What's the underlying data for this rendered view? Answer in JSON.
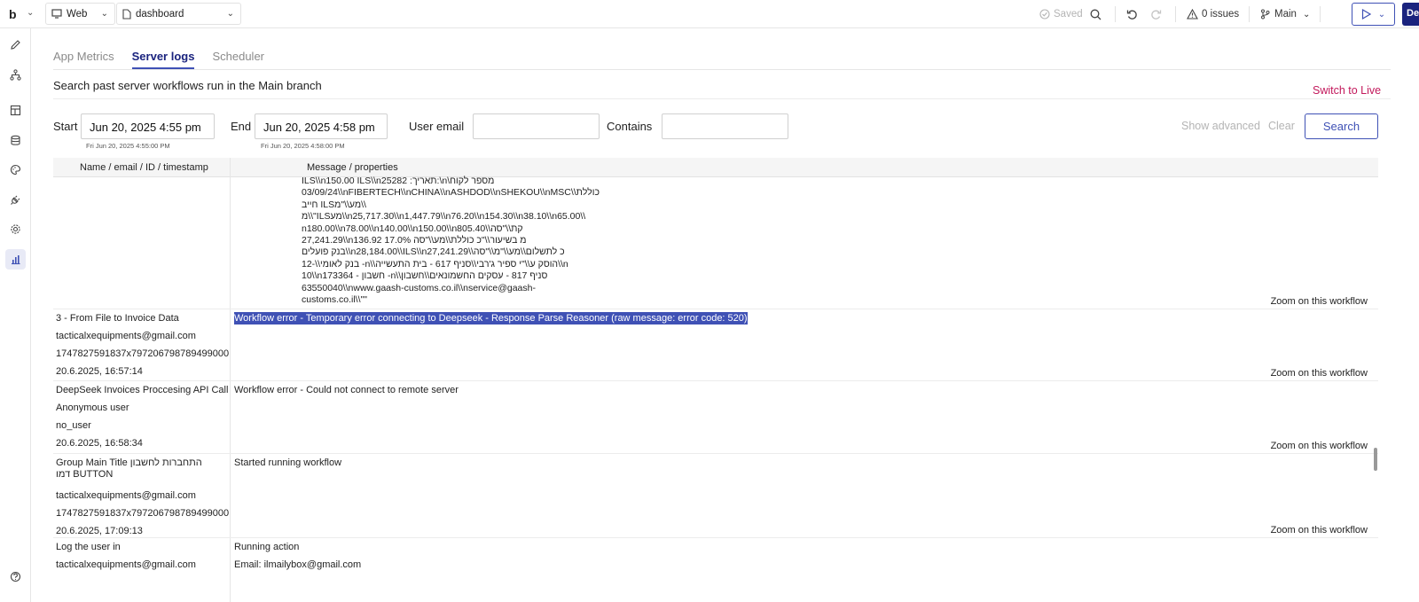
{
  "topbar": {
    "logo": "b",
    "platform": "Web",
    "page": "dashboard",
    "saved": "Saved",
    "issues": "0 issues",
    "branch": "Main",
    "deploy": "Deploy"
  },
  "tabs": [
    "App Metrics",
    "Server logs",
    "Scheduler"
  ],
  "description": "Search past server workflows run in the Main branch",
  "switch_live": "Switch to Live",
  "filters": {
    "start_label": "Start",
    "start_value": "Jun 20, 2025 4:55 pm",
    "start_sub": "Fri Jun 20, 2025 4:55:00 PM",
    "end_label": "End",
    "end_value": "Jun 20, 2025 4:58 pm",
    "end_sub": "Fri Jun 20, 2025 4:58:00 PM",
    "email_label": "User email",
    "email_value": "",
    "contains_label": "Contains",
    "contains_value": "",
    "show_advanced": "Show advanced",
    "clear": "Clear",
    "search": "Search"
  },
  "table": {
    "headers": [
      "Name / email / ID / timestamp",
      "Message / properties"
    ],
    "zoom_label": "Zoom on this workflow",
    "first_row_lines": [
      "ILS\\\\n150.00 ILS\\\\n25282 :תאריך:\\n\\מספר לקוח",
      "03/09/24\\\\nFIBERTECH\\\\nCHINA\\\\nASHDOD\\\\nSHEKOU\\\\nMSC\\\\כוללת",
      "חייב ILSמע\\\\\"מ\\\\",
      "מ\\\\\"ILSמע\\\\n25,717.30\\\\n1,447.79\\\\n76.20\\\\n154.30\\\\n38.10\\\\n65.00\\\\",
      "n180.00\\\\n78.00\\\\n140.00\\\\n150.00\\\\n805.40\\\\קת\\\\\"סה",
      "27,241.29\\\\n136.92 17.0% מ בשיעור\\\\\"כ כוללת\\\\מע\\\\\"סה",
      "בנק פועלים\\\\n28,184.00\\\\ILS\\\\n27,241.29\\\\כ לתשלום\\\\מע\\\\\"מ\\\\\"סה",
      "12-\\\\בנק לאומי -n\\\\הוסק ע\\\\\"י ספיר ג'רבי\\\\סניף 617 - בית התעשייה\\\\n",
      "10\\\\n173364 - חשבון -n\\\\סניף 817 - עסקים החשמונאים\\\\חשבון",
      "63550040\\\\nwww.gaash-customs.co.il\\\\nservice@gaash-",
      "customs.co.il\\\\\"\""
    ],
    "rows": [
      {
        "name": "3 - From File to Invoice Data",
        "email": "tacticalxequipments@gmail.com",
        "id": "1747827591837x797206798789499000",
        "timestamp": "20.6.2025, 16:57:14",
        "message": "Workflow error - Temporary error connecting to Deepseek - Response Parse Reasoner (raw message: error code: 520)"
      },
      {
        "name": "DeepSeek Invoices Proccesing API Call",
        "email": "Anonymous user",
        "id": "no_user",
        "timestamp": "20.6.2025, 16:58:34",
        "message": "Workflow error - Could not connect to remote server"
      },
      {
        "name": "Group Main Title התחברות לחשבון דמו BUTTON",
        "email": "tacticalxequipments@gmail.com",
        "id": "1747827591837x797206798789499000",
        "timestamp": "20.6.2025, 17:09:13",
        "message": "Started running workflow"
      },
      {
        "name": "Log the user in",
        "email": "tacticalxequipments@gmail.com",
        "message": "Running action",
        "message2": "Email: ilmailybox@gmail.com"
      }
    ]
  },
  "colors": {
    "accent": "#3f51b5",
    "accent_dark": "#1a237e",
    "switch_live": "#c2185b",
    "highlight": "#3f51b5"
  }
}
